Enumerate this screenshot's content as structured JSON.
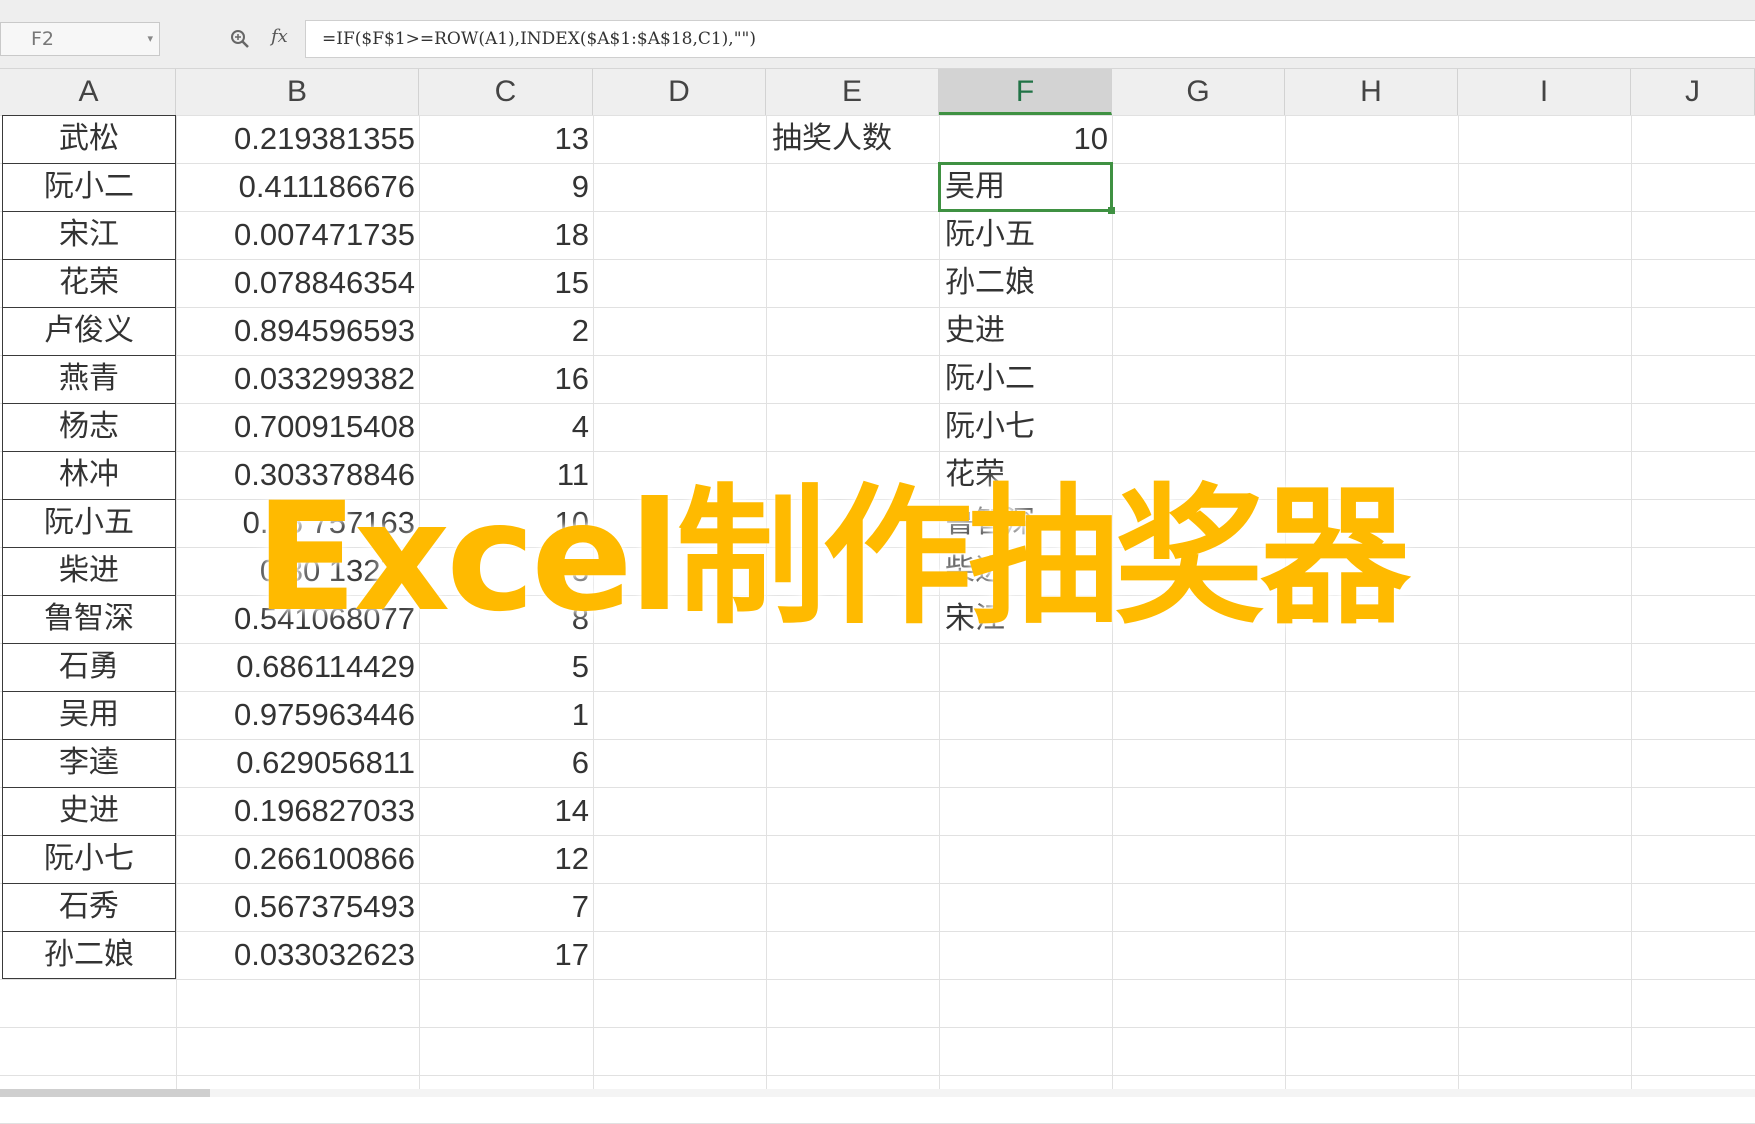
{
  "formula_bar": {
    "cell_ref": "F2",
    "fx_label": "fx",
    "formula": "=IF($F$1>=ROW(A1),INDEX($A$1:$A$18,C1),\"\")"
  },
  "columns": [
    "A",
    "B",
    "C",
    "D",
    "E",
    "F",
    "G",
    "H",
    "I",
    "J"
  ],
  "active_column": "F",
  "rows": [
    {
      "name": "武松",
      "rand": "0.219381355",
      "rank": "13"
    },
    {
      "name": "阮小二",
      "rand": "0.411186676",
      "rank": "9"
    },
    {
      "name": "宋江",
      "rand": "0.007471735",
      "rank": "18"
    },
    {
      "name": "花荣",
      "rand": "0.078846354",
      "rank": "15"
    },
    {
      "name": "卢俊义",
      "rand": "0.894596593",
      "rank": "2"
    },
    {
      "name": "燕青",
      "rand": "0.033299382",
      "rank": "16"
    },
    {
      "name": "杨志",
      "rand": "0.700915408",
      "rank": "4"
    },
    {
      "name": "林冲",
      "rand": "0.303378846",
      "rank": "11"
    },
    {
      "name": "阮小五",
      "rand": "0.35 757163",
      "rank": "10"
    },
    {
      "name": "柴进",
      "rand": "0.80 13276",
      "rank": "3"
    },
    {
      "name": "鲁智深",
      "rand": "0.541068077",
      "rank": "8"
    },
    {
      "name": "石勇",
      "rand": "0.686114429",
      "rank": "5"
    },
    {
      "name": "吴用",
      "rand": "0.975963446",
      "rank": "1"
    },
    {
      "name": "李逵",
      "rand": "0.629056811",
      "rank": "6"
    },
    {
      "name": "史进",
      "rand": "0.196827033",
      "rank": "14"
    },
    {
      "name": "阮小七",
      "rand": "0.266100866",
      "rank": "12"
    },
    {
      "name": "石秀",
      "rand": "0.567375493",
      "rank": "7"
    },
    {
      "name": "孙二娘",
      "rand": "0.033032623",
      "rank": "17"
    }
  ],
  "lottery": {
    "label": "抽奖人数",
    "count": "10",
    "winners": [
      "吴用",
      "阮小五",
      "孙二娘",
      "史进",
      "阮小二",
      "阮小七",
      "花荣",
      "鲁智深",
      "柴进",
      "宋江"
    ]
  },
  "overlay_title": "Excel制作抽奖器",
  "colors": {
    "accent_green": "#3f9142",
    "title_yellow": "#ffba00"
  }
}
